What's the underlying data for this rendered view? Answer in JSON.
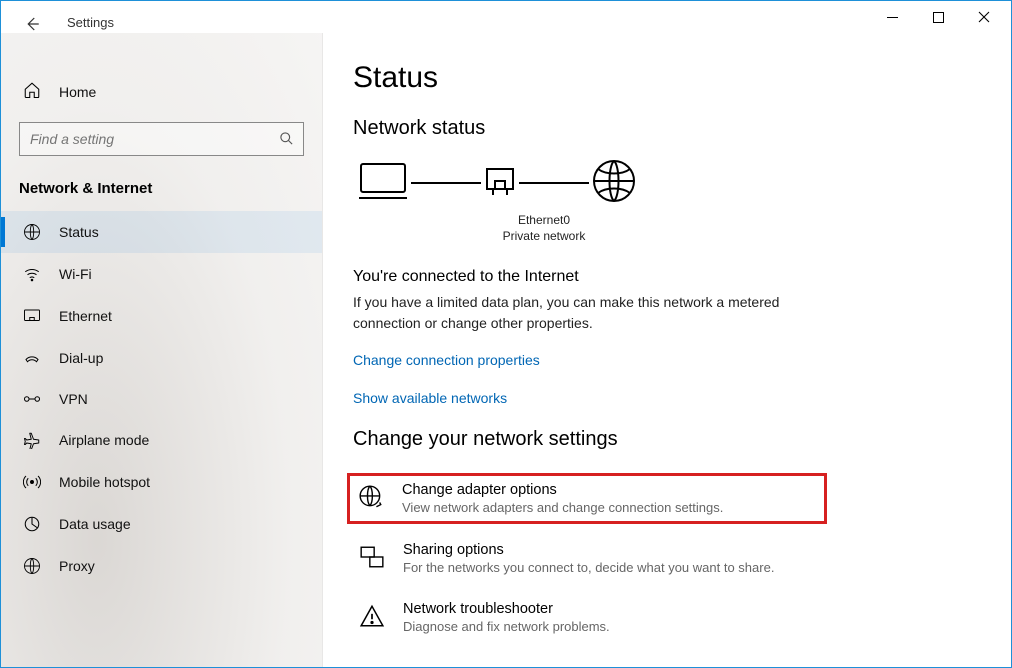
{
  "window": {
    "title": "Settings"
  },
  "sidebar": {
    "home": "Home",
    "searchPlaceholder": "Find a setting",
    "section": "Network & Internet",
    "items": [
      {
        "label": "Status"
      },
      {
        "label": "Wi-Fi"
      },
      {
        "label": "Ethernet"
      },
      {
        "label": "Dial-up"
      },
      {
        "label": "VPN"
      },
      {
        "label": "Airplane mode"
      },
      {
        "label": "Mobile hotspot"
      },
      {
        "label": "Data usage"
      },
      {
        "label": "Proxy"
      }
    ]
  },
  "page": {
    "title": "Status",
    "networkStatusHeading": "Network status",
    "diagram": {
      "adapterName": "Ethernet0",
      "networkType": "Private network"
    },
    "connectedHeading": "You're connected to the Internet",
    "connectedBody": "If you have a limited data plan, you can make this network a metered connection or change other properties.",
    "linkChangeProps": "Change connection properties",
    "linkShowNetworks": "Show available networks",
    "changeSettingsHeading": "Change your network settings",
    "items": [
      {
        "title": "Change adapter options",
        "desc": "View network adapters and change connection settings."
      },
      {
        "title": "Sharing options",
        "desc": "For the networks you connect to, decide what you want to share."
      },
      {
        "title": "Network troubleshooter",
        "desc": "Diagnose and fix network problems."
      }
    ]
  }
}
